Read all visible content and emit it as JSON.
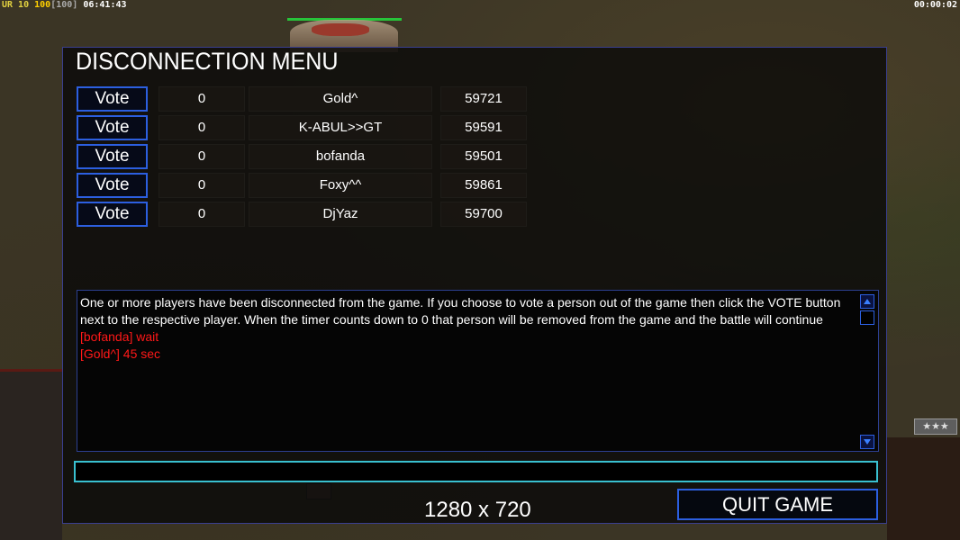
{
  "hud": {
    "top_left": {
      "a": "UR 10",
      "b": "100",
      "c": "[100]",
      "d": "06:41:43"
    },
    "top_right": "00:00:02",
    "rank_stars": "★★★"
  },
  "dialog": {
    "title": "DISCONNECTION MENU",
    "players": [
      {
        "vote_label": "Vote",
        "votes": "0",
        "name": "Gold^",
        "packet": "59721"
      },
      {
        "vote_label": "Vote",
        "votes": "0",
        "name": "K-ABUL>>GT",
        "packet": "59591"
      },
      {
        "vote_label": "Vote",
        "votes": "0",
        "name": "bofanda",
        "packet": "59501"
      },
      {
        "vote_label": "Vote",
        "votes": "0",
        "name": "Foxy^^",
        "packet": "59861"
      },
      {
        "vote_label": "Vote",
        "votes": "0",
        "name": "DjYaz",
        "packet": "59700"
      }
    ],
    "messages": [
      {
        "text": "One or more players have been disconnected from the game. If you choose to vote a person out of the game then click the VOTE button next to the respective player. When the timer counts down to 0 that person will be removed from the game and the battle will continue",
        "color": "#ffffff"
      },
      {
        "text": "[bofanda] wait",
        "color": "#ff1818"
      },
      {
        "text": "[Gold^] 45 sec",
        "color": "#ff1818"
      }
    ],
    "chat_input": {
      "value": "",
      "placeholder": ""
    },
    "quit_label": "QUIT GAME"
  },
  "overlay_resolution": "1280 x 720"
}
